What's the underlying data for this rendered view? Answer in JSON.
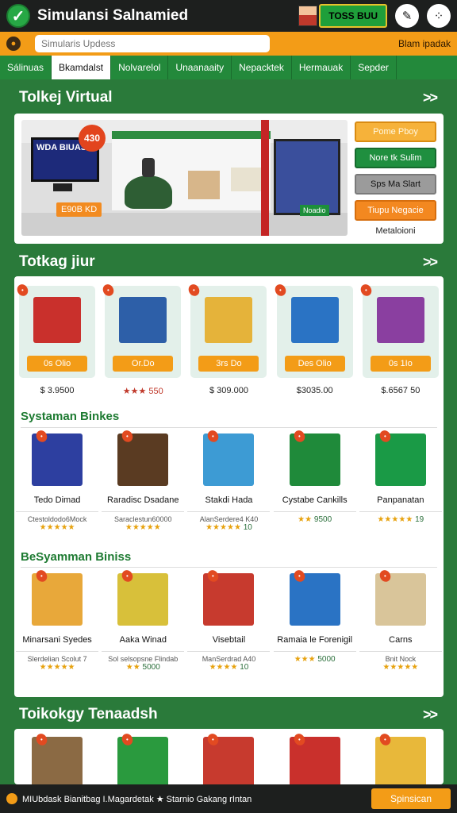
{
  "header": {
    "title": "Simulansi Salnamied",
    "badge": "TOSS BUU",
    "icons": [
      "check-icon",
      "avatar",
      "wrench-icon",
      "dots-icon"
    ]
  },
  "search": {
    "placeholder": "Simularis Updess",
    "right_label": "Blam ipadak"
  },
  "tabs": [
    "Sálinuas",
    "Bkamdalst",
    "Nolvarelol",
    "Unaanaaity",
    "Nepacktek",
    "Hermauak",
    "Sepder"
  ],
  "active_tab": 1,
  "section1": {
    "title": "Tolkej Virtual",
    "scene_tv_text": "WDA BIUASH",
    "scene_price": "430",
    "scene_price_tag": "E90B KD",
    "scene_vending_label": "Noadio",
    "buttons": [
      "Pome Pboy",
      "Nore tk Sulim",
      "Sps Ma Slart",
      "Tiupu Negacie"
    ],
    "buttons_note": "Metaloioni"
  },
  "section2": {
    "title": "Totkag jiur",
    "products": [
      {
        "btn": "0s Olio",
        "price": "$ 3.9500",
        "red": false
      },
      {
        "btn": "Or.Do",
        "price": "★★★ 550",
        "red": true
      },
      {
        "btn": "3rs Do",
        "price": "$ 309.000",
        "red": false
      },
      {
        "btn": "Des Olio",
        "price": "$3035.00",
        "red": false
      },
      {
        "btn": "0s 1Io",
        "price": "$.6567 50",
        "red": false
      }
    ],
    "sub1": {
      "title": "Systaman Binkes",
      "items": [
        {
          "name": "Tedo Dimad",
          "sub": "Ctestoldodo6Mock",
          "stars": "★★★★★",
          "val": ""
        },
        {
          "name": "Raradisc Dsadane",
          "sub": "Saraclestun60000",
          "stars": "★★★★★",
          "val": ""
        },
        {
          "name": "Stakdi Hada",
          "sub": "AlanSerdere4 K40",
          "stars": "★★★★★",
          "val": "10"
        },
        {
          "name": "Cystabe Cankills",
          "sub": "",
          "stars": "★★",
          "val": "9500"
        },
        {
          "name": "Panpanatan",
          "sub": "",
          "stars": "★★★★★",
          "val": "19"
        }
      ]
    },
    "sub2": {
      "title": "BeSyamman Biniss",
      "items": [
        {
          "name": "Minarsani Syedes",
          "sub": "Slerdelian Scolut 7",
          "stars": "★★★★★",
          "val": ""
        },
        {
          "name": "Aaka Winad",
          "sub": "Sol selsopsne Flindab",
          "stars": "★★",
          "val": "5000"
        },
        {
          "name": "Visebtail",
          "sub": "ManSerdrad A40",
          "stars": "★★★★",
          "val": "10"
        },
        {
          "name": "Ramaia le Forenigil",
          "sub": "",
          "stars": "★★★",
          "val": "5000"
        },
        {
          "name": "Carns",
          "sub": "Bnit Nock",
          "stars": "★★★★★",
          "val": ""
        }
      ]
    }
  },
  "section3": {
    "title": "Toikokgy Tenaadsh"
  },
  "footer": {
    "text": "MIUbdask Bianitbag I.Magardetak  ★ Starnio Gakang rIntan",
    "button": "Spinsican"
  },
  "colors": {
    "green": "#23893b",
    "orange": "#f39c17",
    "dark": "#1d1f1e"
  }
}
